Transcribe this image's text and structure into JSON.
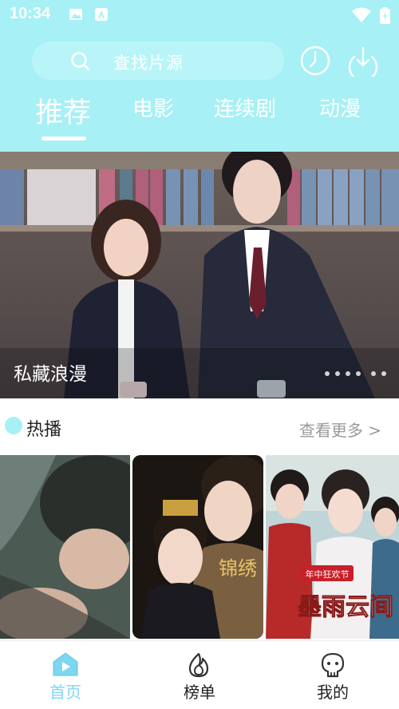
{
  "status_bar": {
    "time": "10:34",
    "icons": [
      "gallery-icon",
      "store-icon",
      "wifi-icon",
      "battery-icon"
    ]
  },
  "search": {
    "placeholder": "查找片源"
  },
  "header_actions": [
    "history-icon",
    "download-icon"
  ],
  "tabs": [
    {
      "label": "推荐",
      "active": true
    },
    {
      "label": "电影",
      "active": false
    },
    {
      "label": "连续剧",
      "active": false
    },
    {
      "label": "动漫",
      "active": false
    }
  ],
  "banner": {
    "caption": "私藏浪漫",
    "dot_count": 6
  },
  "hot_section": {
    "title": "热播",
    "more_label": "查看更多 >",
    "posters": [
      {
        "name": "poster-1"
      },
      {
        "name": "poster-2",
        "title_art": "锦绣"
      },
      {
        "name": "poster-3",
        "title_art": "墨雨云间",
        "badge": "年中狂欢节"
      }
    ]
  },
  "bottom_nav": [
    {
      "label": "首页",
      "icon": "home-play-icon",
      "active": true
    },
    {
      "label": "榜单",
      "icon": "flame-icon",
      "active": false
    },
    {
      "label": "我的",
      "icon": "profile-icon",
      "active": false
    }
  ],
  "colors": {
    "header_bg": "#a7f0f5",
    "active_nav": "#7fd6f0",
    "muted_text": "#9a9a9a"
  }
}
